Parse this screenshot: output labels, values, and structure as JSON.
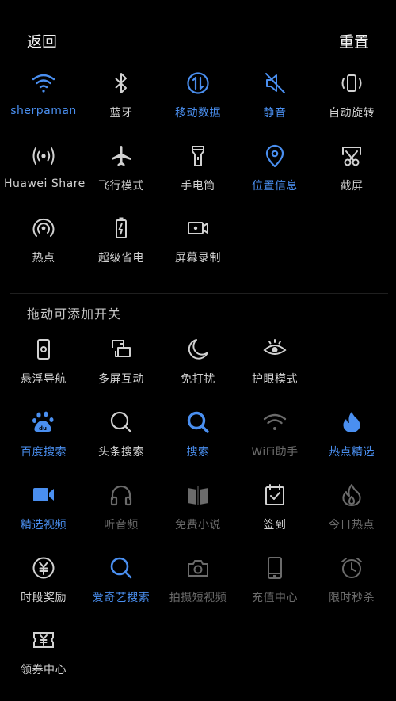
{
  "header": {
    "back_label": "返回",
    "reset_label": "重置"
  },
  "active_tiles": {
    "wifi": "sherpaman",
    "bluetooth": "蓝牙",
    "mobile_data": "移动数据",
    "mute": "静音",
    "auto_rotate": "自动旋转",
    "huawei_share": "Huawei Share",
    "airplane": "飞行模式",
    "flashlight": "手电筒",
    "location": "位置信息",
    "screenshot": "截屏",
    "hotspot": "热点",
    "power_saving": "超级省电",
    "screen_record": "屏幕录制"
  },
  "drag_section": {
    "title": "拖动可添加开关",
    "floating_nav": "悬浮导航",
    "multi_screen": "多屏互动",
    "do_not_disturb": "免打扰",
    "eye_comfort": "护眼模式"
  },
  "app_shortcuts": {
    "baidu_search": "百度搜索",
    "toutiao_search": "头条搜索",
    "search": "搜索",
    "wifi_assistant": "WiFi助手",
    "hot_picks": "热点精选",
    "featured_video": "精选视频",
    "listen_audio": "听音频",
    "free_novel": "免费小说",
    "check_in": "签到",
    "today_hot": "今日热点",
    "time_reward": "时段奖励",
    "iqiyi_search": "爱奇艺搜索",
    "short_video": "拍摄短视频",
    "recharge_center": "充值中心",
    "flash_sale": "限时秒杀",
    "coupon_center": "领券中心"
  },
  "colors": {
    "accent": "#4a8ff0",
    "normal": "#d2d2d2",
    "dim": "#6b6b6b",
    "background": "#000000"
  }
}
